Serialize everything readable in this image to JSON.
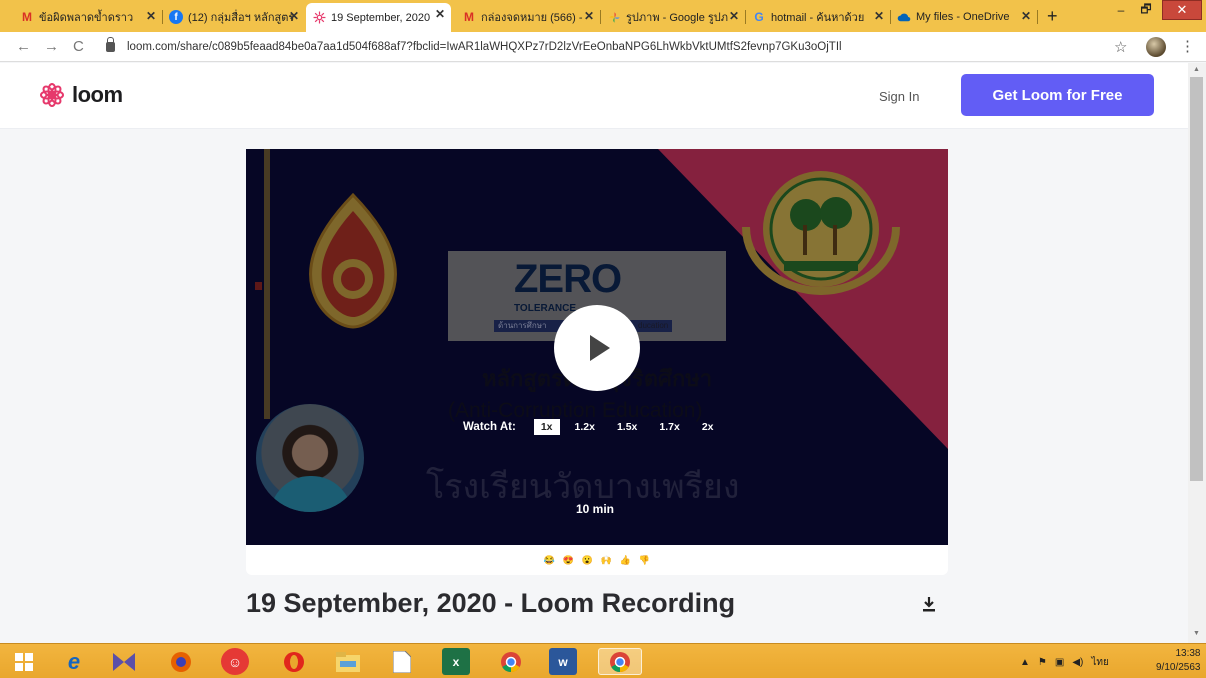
{
  "browser": {
    "tabs": [
      {
        "title": "ข้อผิดพลาดข้ำดราว",
        "icon": "gmail-icon",
        "active": false
      },
      {
        "title": "(12) กลุ่มสื่อฯ หลักสูตร",
        "icon": "facebook-icon",
        "active": false
      },
      {
        "title": "19 September, 2020",
        "icon": "loom-icon",
        "active": true
      },
      {
        "title": "กล่องจดหมาย (566) -",
        "icon": "gmail-icon",
        "active": false
      },
      {
        "title": "รูปภาพ - Google รูปภ",
        "icon": "google-photos-icon",
        "active": false
      },
      {
        "title": "hotmail - ค้นหาด้วย",
        "icon": "google-icon",
        "active": false
      },
      {
        "title": "My files - OneDrive",
        "icon": "onedrive-icon",
        "active": false
      }
    ],
    "new_tab": "+",
    "url": "loom.com/share/c089b5feaad84be0a7aa1d504f688af7?fbclid=IwAR1laWHQXPz7rD2lzVrEeOnbaNPG6LhWkbVktUMtfS2fevnp7GKu3oOjTIl",
    "window_controls": {
      "minimize": "–",
      "maximize": "🗗",
      "close": "✕"
    }
  },
  "loom": {
    "logo_text": "loom",
    "sign_in": "Sign In",
    "cta": "Get Loom for Free",
    "video": {
      "slide_zero": "ZERO",
      "slide_tolerance": "TOLERANCE",
      "slide_bar_left": "ด้านการศึกษา",
      "slide_bar_right": "ducation",
      "slide_title_thai": "หลักสูตรต้านทุจริตศึกษา",
      "slide_title_en": "(Anti-Corruption Education)",
      "school_name": "โรงเรียนวัดบางเพรียง",
      "watch_at_label": "Watch At:",
      "speeds": [
        "1x",
        "1.2x",
        "1.5x",
        "1.7x",
        "2x"
      ],
      "selected_speed": "1x",
      "duration": "10 min",
      "accent_pink": "#e6396c",
      "bg_navy": "#0c0c40"
    },
    "reactions": [
      "😂",
      "😍",
      "😮",
      "🙌",
      "👍",
      "👎"
    ],
    "video_title": "19 September, 2020 - Loom Recording",
    "brand_color": "#625df5"
  },
  "taskbar": {
    "apps": [
      "windows-start-icon",
      "ie-icon",
      "teams-icon",
      "firefox-icon",
      "baidu-icon",
      "opera-icon",
      "file-explorer-icon",
      "notepad-icon",
      "excel-icon",
      "chrome-icon",
      "word-icon",
      "chrome-active-icon"
    ],
    "language": "ไทย",
    "time": "13:38",
    "date": "9/10/2563"
  }
}
